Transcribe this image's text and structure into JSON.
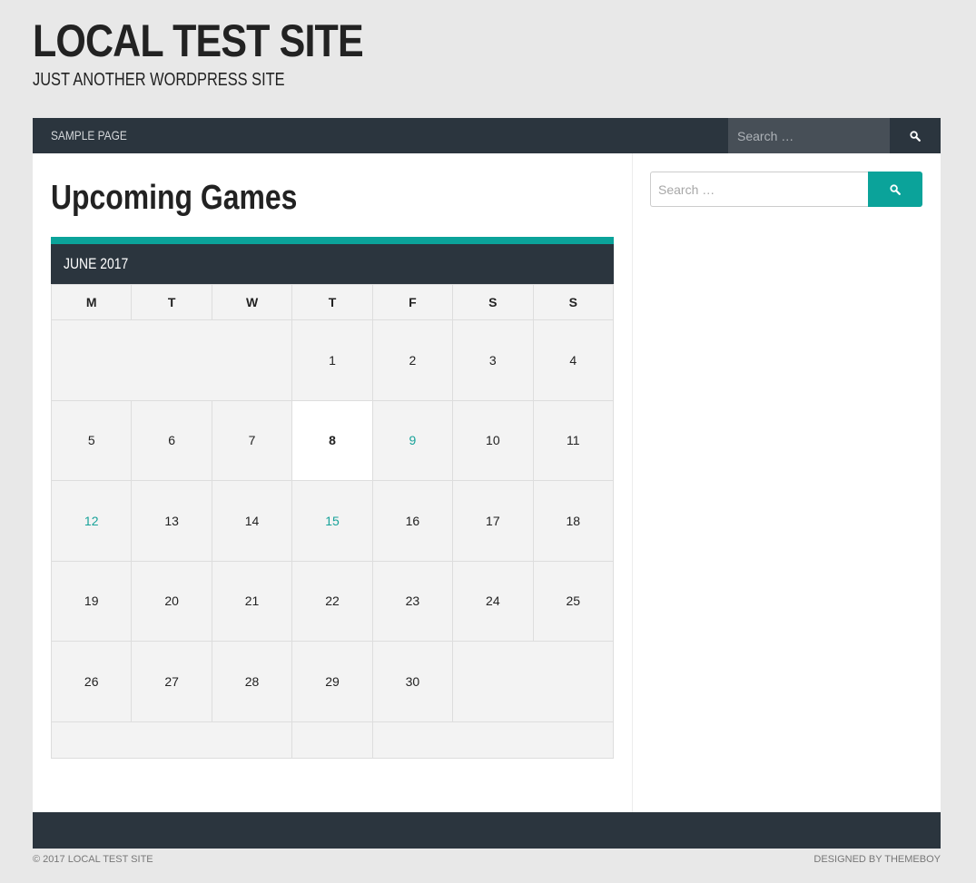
{
  "site": {
    "title": "LOCAL TEST SITE",
    "tagline": "JUST ANOTHER WORDPRESS SITE"
  },
  "nav": {
    "items": [
      {
        "label": "SAMPLE PAGE"
      }
    ],
    "search_placeholder": "Search …",
    "search_icon": "search-icon"
  },
  "page": {
    "title": "Upcoming Games"
  },
  "calendar": {
    "caption": "JUNE 2017",
    "weekdays": [
      "M",
      "T",
      "W",
      "T",
      "F",
      "S",
      "S"
    ],
    "today": "8",
    "event_days": [
      "9",
      "12",
      "15"
    ],
    "weeks": [
      [
        null,
        null,
        null,
        "1",
        "2",
        "3",
        "4"
      ],
      [
        "5",
        "6",
        "7",
        "8",
        "9",
        "10",
        "11"
      ],
      [
        "12",
        "13",
        "14",
        "15",
        "16",
        "17",
        "18"
      ],
      [
        "19",
        "20",
        "21",
        "22",
        "23",
        "24",
        "25"
      ],
      [
        "26",
        "27",
        "28",
        "29",
        "30",
        null,
        null
      ]
    ]
  },
  "sidebar": {
    "search_placeholder": "Search …",
    "search_icon": "search-icon"
  },
  "footer": {
    "copyright": "© 2017 LOCAL TEST SITE",
    "credit": "DESIGNED BY THEMEBOY"
  },
  "colors": {
    "accent": "#0ba39a",
    "dark": "#2b353e",
    "background": "#e8e8e8"
  }
}
